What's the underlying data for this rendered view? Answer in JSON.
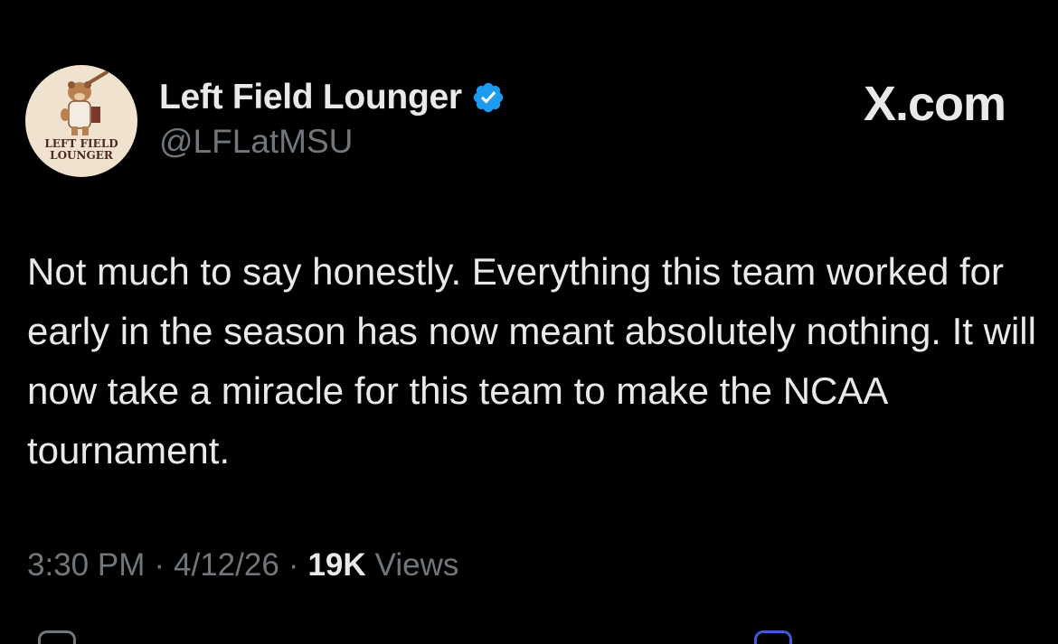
{
  "tweet": {
    "author": {
      "display_name": "Left Field Lounger",
      "handle": "@LFLatMSU",
      "verified": true,
      "avatar_text_line1": "LEFT FIELD",
      "avatar_text_line2": "LOUNGER"
    },
    "brand": "X.com",
    "text": "Not much to say honestly. Everything this team worked for early in the season has now meant absolutely nothing. It will now take a miracle for this team to make the NCAA tournament.",
    "time": "3:30 PM",
    "date": "4/12/26",
    "views_count": "19K",
    "views_label": "Views",
    "separator": "·"
  },
  "colors": {
    "background": "#000000",
    "primary_text": "#e7e9ea",
    "secondary_text": "#71767b",
    "verified_blue": "#1d9bf0",
    "avatar_bg": "#efe2cf"
  },
  "icons": {
    "verified": "verified-badge-icon",
    "bottom_actions": [
      "reply-icon",
      "bookmark-icon"
    ]
  }
}
